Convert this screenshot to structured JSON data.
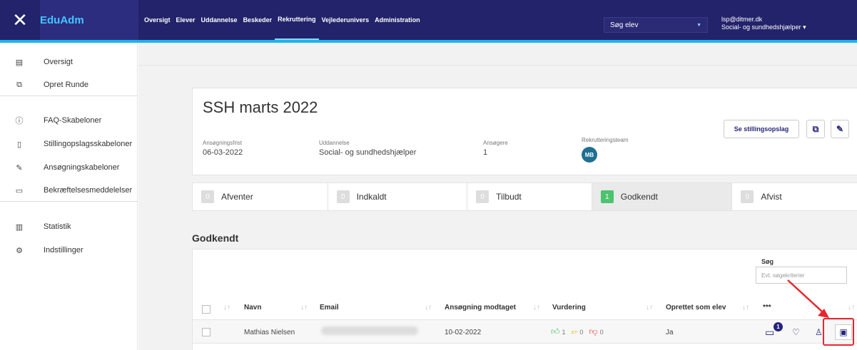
{
  "app": {
    "brand": "EduAdm",
    "close_label": "✕"
  },
  "nav": [
    "Oversigt",
    "Elever",
    "Uddannelse",
    "Beskeder",
    "Rekruttering",
    "Vejlederunivers",
    "Administration"
  ],
  "search_student": {
    "label": "Søg elev"
  },
  "user": {
    "email": "lsp@ditmer.dk",
    "role": "Social- og sundhedshjælper"
  },
  "sidebar": {
    "items": [
      {
        "label": "Oversigt",
        "icon": "calendar-icon"
      },
      {
        "label": "Opret Runde",
        "icon": "add-round-icon"
      },
      {
        "label": "FAQ-Skabeloner",
        "icon": "info-icon"
      },
      {
        "label": "Stillingopslagsskabeloner",
        "icon": "document-icon"
      },
      {
        "label": "Ansøgningskabeloner",
        "icon": "pencil-icon"
      },
      {
        "label": "Bekræftelsesmeddelelser",
        "icon": "chat-icon"
      },
      {
        "label": "Statistik",
        "icon": "chart-icon"
      },
      {
        "label": "Indstillinger",
        "icon": "settings-icon"
      }
    ]
  },
  "round": {
    "title": "SSH marts 2022",
    "deadline_label": "Ansøgningsfrist",
    "deadline": "06-03-2022",
    "education_label": "Uddannelse",
    "education": "Social- og sundhedshjælper",
    "applicants_label": "Ansøgere",
    "applicants": "1",
    "team_label": "Rekrutteringsteam",
    "team_avatar": "MB",
    "view_posting_button": "Se stillingsopslag"
  },
  "statuses": [
    {
      "count": "0",
      "label": "Afventer"
    },
    {
      "count": "0",
      "label": "Indkaldt"
    },
    {
      "count": "0",
      "label": "Tilbudt"
    },
    {
      "count": "1",
      "label": "Godkendt"
    },
    {
      "count": "0",
      "label": "Afvist"
    }
  ],
  "table": {
    "section_title": "Godkendt",
    "search_label": "Søg",
    "search_placeholder": "Evt. søgekriterier",
    "headers": [
      "Navn",
      "Email",
      "Ansøgning modtaget",
      "Vurdering",
      "Oprettet som elev",
      "***"
    ],
    "rows": [
      {
        "name": "Mathias Nielsen",
        "received": "10-02-2022",
        "rating_up": "1",
        "rating_mid": "0",
        "rating_down": "0",
        "created_as_student": "Ja",
        "message_count": "1"
      }
    ]
  },
  "colors": {
    "topbar": "#23236b",
    "accent": "#19b4eb",
    "brand_text": "#3fc7ff",
    "approved": "#4cc36f",
    "highlight": "#e8262e"
  }
}
